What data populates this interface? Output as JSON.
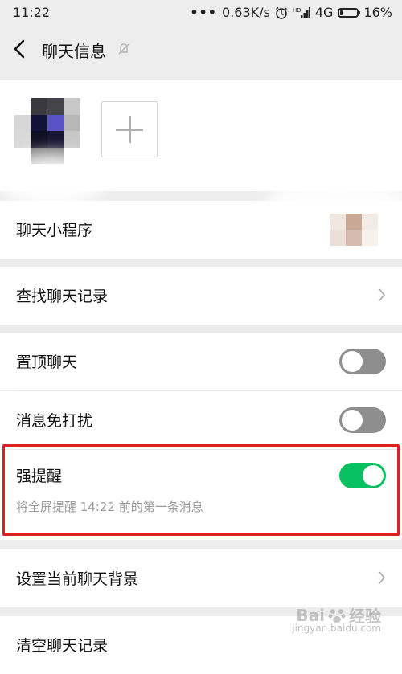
{
  "status_bar": {
    "time": "11:22",
    "dots": "•••",
    "speed": "0.63K/s",
    "network": "4G",
    "battery_level": 0.16,
    "battery": "16%"
  },
  "nav": {
    "title": "聊天信息"
  },
  "rows": {
    "mini_programs": "聊天小程序",
    "search_history": "查找聊天记录",
    "pin_chat": {
      "label": "置顶聊天",
      "on": false
    },
    "mute": {
      "label": "消息免打扰",
      "on": false
    },
    "strong_reminder": {
      "label": "强提醒",
      "on": true,
      "description": "将全屏提醒 14:22 前的第一条消息"
    },
    "set_background": "设置当前聊天背景",
    "clear_history": "清空聊天记录"
  },
  "colors": {
    "accent_green": "#07c160",
    "highlight_red": "#e02020",
    "toggle_off": "#8e8e8e"
  },
  "watermark": {
    "brand": "Bai",
    "brand2": "经验",
    "url": "jingyan.baidu.com"
  }
}
